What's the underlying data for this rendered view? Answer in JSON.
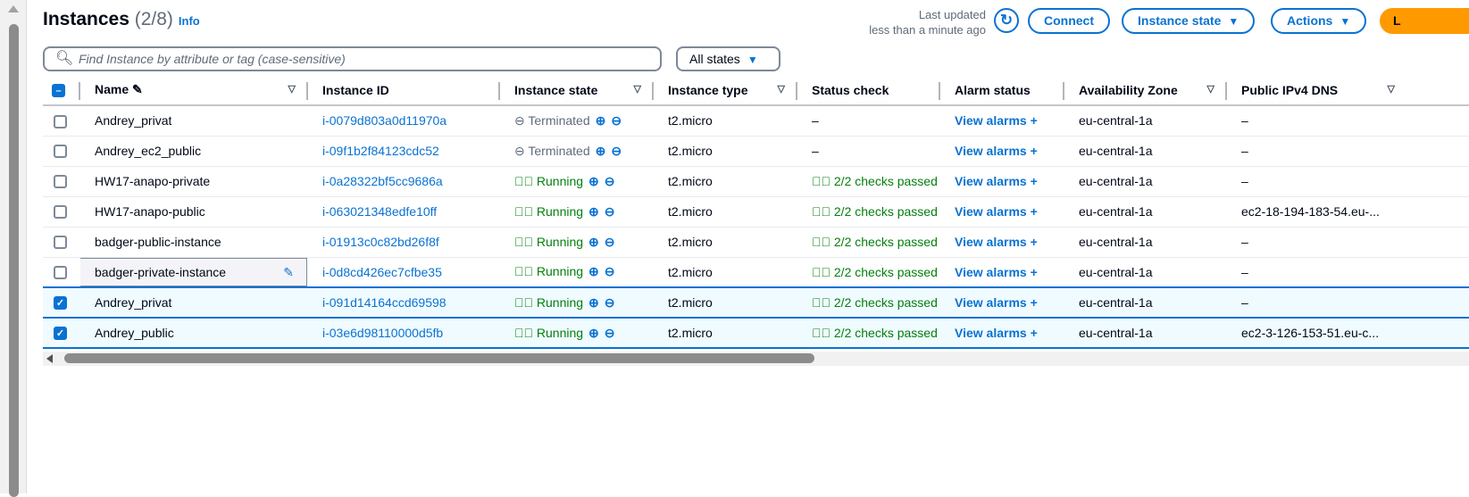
{
  "header": {
    "title": "Instances",
    "count": "(2/8)",
    "info": "Info",
    "last_updated_1": "Last updated",
    "last_updated_2": "less than a minute ago",
    "connect": "Connect",
    "instance_state": "Instance state",
    "actions": "Actions",
    "launch": "L"
  },
  "search": {
    "placeholder": "Find Instance by attribute or tag (case-sensitive)"
  },
  "filter": {
    "value": "All states"
  },
  "columns": [
    "Name",
    "Instance ID",
    "Instance state",
    "Instance type",
    "Status check",
    "Alarm status",
    "Availability Zone",
    "Public IPv4 DNS"
  ],
  "rows": [
    {
      "selected": false,
      "name": "Andrey_privat",
      "id": "i-0079d803a0d11970a",
      "state": "Terminated",
      "type": "t2.micro",
      "status": "–",
      "alarm": "View alarms",
      "az": "eu-central-1a",
      "dns": "–"
    },
    {
      "selected": false,
      "name": "Andrey_ec2_public",
      "id": "i-09f1b2f84123cdc52",
      "state": "Terminated",
      "type": "t2.micro",
      "status": "–",
      "alarm": "View alarms",
      "az": "eu-central-1a",
      "dns": "–"
    },
    {
      "selected": false,
      "name": "HW17-anapo-private",
      "id": "i-0a28322bf5cc9686a",
      "state": "Running",
      "type": "t2.micro",
      "status": "2/2 checks passed",
      "alarm": "View alarms",
      "az": "eu-central-1a",
      "dns": "–"
    },
    {
      "selected": false,
      "name": "HW17-anapo-public",
      "id": "i-063021348edfe10ff",
      "state": "Running",
      "type": "t2.micro",
      "status": "2/2 checks passed",
      "alarm": "View alarms",
      "az": "eu-central-1a",
      "dns": "ec2-18-194-183-54.eu-..."
    },
    {
      "selected": false,
      "name": "badger-public-instance",
      "id": "i-01913c0c82bd26f8f",
      "state": "Running",
      "type": "t2.micro",
      "status": "2/2 checks passed",
      "alarm": "View alarms",
      "az": "eu-central-1a",
      "dns": "–"
    },
    {
      "selected": false,
      "editing": true,
      "name": "badger-private-instance",
      "id": "i-0d8cd426ec7cfbe35",
      "state": "Running",
      "type": "t2.micro",
      "status": "2/2 checks passed",
      "alarm": "View alarms",
      "az": "eu-central-1a",
      "dns": "–"
    },
    {
      "selected": true,
      "name": "Andrey_privat",
      "id": "i-091d14164ccd69598",
      "state": "Running",
      "type": "t2.micro",
      "status": "2/2 checks passed",
      "alarm": "View alarms",
      "az": "eu-central-1a",
      "dns": "–"
    },
    {
      "selected": true,
      "name": "Andrey_public",
      "id": "i-03e6d98110000d5fb",
      "state": "Running",
      "type": "t2.micro",
      "status": "2/2 checks passed",
      "alarm": "View alarms",
      "az": "eu-central-1a",
      "dns": "ec2-3-126-153-51.eu-c..."
    }
  ]
}
